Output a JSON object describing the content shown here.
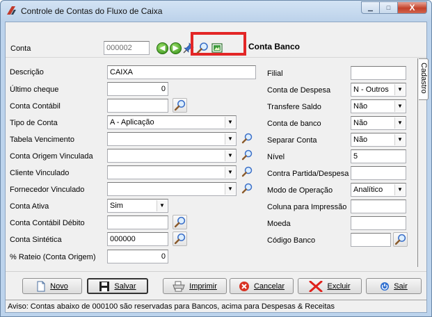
{
  "window": {
    "title": "Controle de Contas do Fluxo de Caixa",
    "buttons": {
      "minimize": "▁",
      "maximize": "□",
      "close": "X"
    }
  },
  "conta": {
    "label": "Conta",
    "value": "000002",
    "tab_title": "Conta Banco"
  },
  "form": {
    "left": {
      "descricao": {
        "label": "Descrição",
        "value": "CAIXA"
      },
      "ultimo_cheque": {
        "label": "Último cheque",
        "value": "0"
      },
      "conta_contabil": {
        "label": "Conta Contábil",
        "value": ""
      },
      "tipo_conta": {
        "label": "Tipo de Conta",
        "value": "A - Aplicação"
      },
      "tabela_vencimento": {
        "label": "Tabela Vencimento",
        "value": ""
      },
      "conta_origem": {
        "label": "Conta Origem Vinculada",
        "value": ""
      },
      "cliente": {
        "label": "Cliente Vinculado",
        "value": ""
      },
      "fornecedor": {
        "label": "Fornecedor Vinculado",
        "value": ""
      },
      "conta_ativa": {
        "label": "Conta Ativa",
        "value": "Sim"
      },
      "contabil_debito": {
        "label": "Conta Contábil Débito",
        "value": ""
      },
      "conta_sintetica": {
        "label": "Conta Sintética",
        "value": "000000"
      },
      "rateio": {
        "label": "% Rateio (Conta Origem)",
        "value": "0"
      }
    },
    "right": {
      "filial": {
        "label": "Filial",
        "value": ""
      },
      "conta_despesa": {
        "label": "Conta de Despesa",
        "value": "N - Outros"
      },
      "transfere_saldo": {
        "label": "Transfere Saldo",
        "value": "Não"
      },
      "conta_banco": {
        "label": "Conta de banco",
        "value": "Não"
      },
      "separar_conta": {
        "label": "Separar Conta",
        "value": "Não"
      },
      "nivel": {
        "label": "Nível",
        "value": "5"
      },
      "contra_partida": {
        "label": "Contra Partida/Despesa",
        "value": ""
      },
      "modo_operacao": {
        "label": "Modo de Operação",
        "value": "Analítico"
      },
      "coluna_impressao": {
        "label": "Coluna para Impressão",
        "value": ""
      },
      "moeda": {
        "label": "Moeda",
        "value": ""
      },
      "codigo_banco": {
        "label": "Código Banco",
        "value": ""
      }
    },
    "side_tab": "Cadastro"
  },
  "actions": {
    "novo": "Novo",
    "salvar": "Salvar",
    "imprimir": "Imprimir",
    "cancelar": "Cancelar",
    "excluir": "Excluir",
    "sair": "Sair"
  },
  "status": "Aviso: Contas abaixo de 000100 são reservadas para Bancos, acima para Despesas & Receitas",
  "colors": {
    "highlight": "#e32626",
    "title_bar": "#bcd2ea",
    "nav_green": "#2e8a12"
  }
}
